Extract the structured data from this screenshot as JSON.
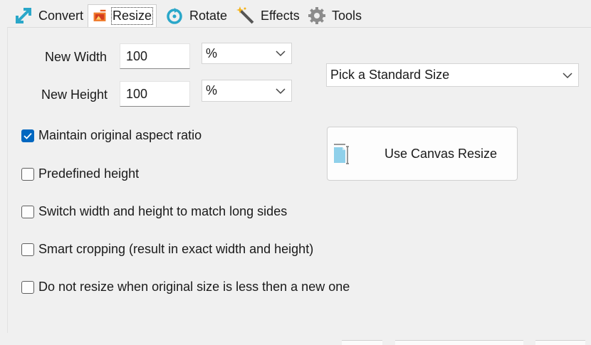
{
  "tabs": [
    {
      "label": "Convert",
      "icon": "convert-arrows-icon"
    },
    {
      "label": "Resize",
      "icon": "resize-image-icon",
      "active": true
    },
    {
      "label": "Rotate",
      "icon": "rotate-icon"
    },
    {
      "label": "Effects",
      "icon": "magic-wand-icon"
    },
    {
      "label": "Tools",
      "icon": "gear-icon"
    }
  ],
  "resize": {
    "width_label": "New Width",
    "width_value": "100",
    "width_unit": "%",
    "height_label": "New Height",
    "height_value": "100",
    "height_unit": "%",
    "standard_size": "Pick a Standard Size",
    "canvas_button": "Use Canvas Resize"
  },
  "options": [
    {
      "label": "Maintain original aspect ratio",
      "checked": true
    },
    {
      "label": "Predefined height",
      "checked": false
    },
    {
      "label": "Switch width and height to match long sides",
      "checked": false
    },
    {
      "label": "Smart cropping (result in exact width and height)",
      "checked": false
    },
    {
      "label": "Do not resize when original size is less then a new one",
      "checked": false
    }
  ],
  "colors": {
    "accent": "#0067c0",
    "background": "#f0f0f0"
  }
}
